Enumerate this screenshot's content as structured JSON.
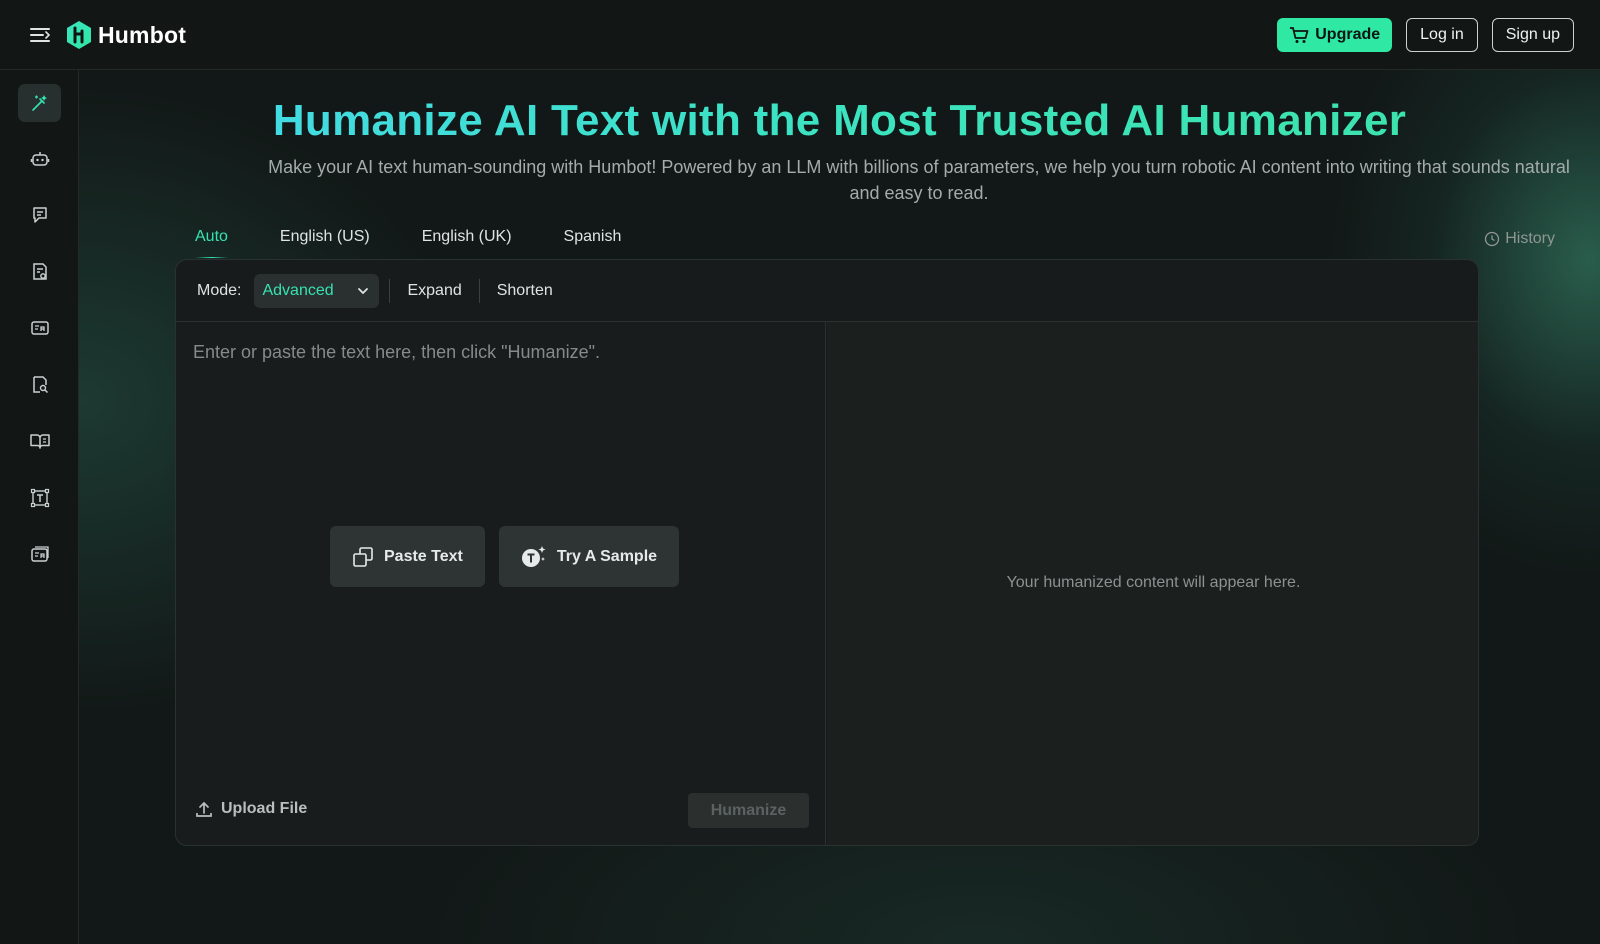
{
  "header": {
    "logo_text": "Humbot",
    "upgrade_label": "Upgrade",
    "login_label": "Log in",
    "signup_label": "Sign up"
  },
  "sidebar": {
    "items": [
      {
        "icon": "magic-pen-icon",
        "active": true
      },
      {
        "icon": "robot-icon",
        "active": false
      },
      {
        "icon": "chat-doc-icon",
        "active": false
      },
      {
        "icon": "doc-check-icon",
        "active": false
      },
      {
        "icon": "translate-icon",
        "active": false
      },
      {
        "icon": "doc-search-icon",
        "active": false
      },
      {
        "icon": "book-icon",
        "active": false
      },
      {
        "icon": "text-frame-icon",
        "active": false
      },
      {
        "icon": "translate-card-icon",
        "active": false
      }
    ]
  },
  "hero": {
    "title": "Humanize AI Text with the Most Trusted AI Humanizer",
    "subtitle": "Make your AI text human-sounding with Humbot! Powered by an LLM with billions of parameters, we help you turn robotic AI content into writing that sounds natural and easy to read."
  },
  "tabs": [
    {
      "label": "Auto",
      "active": true
    },
    {
      "label": "English (US)",
      "active": false
    },
    {
      "label": "English (UK)",
      "active": false
    },
    {
      "label": "Spanish",
      "active": false
    }
  ],
  "history_label": "History",
  "editor": {
    "mode_label": "Mode:",
    "mode_value": "Advanced",
    "expand_label": "Expand",
    "shorten_label": "Shorten",
    "input_placeholder": "Enter or paste the text here, then click \"Humanize\".",
    "paste_label": "Paste Text",
    "sample_label": "Try A Sample",
    "upload_label": "Upload File",
    "humanize_label": "Humanize",
    "output_placeholder": "Your humanized content will appear here."
  },
  "colors": {
    "accent": "#2ee8a3",
    "title_gradient_start": "#46d8ef",
    "title_gradient_end": "#3ee3a6",
    "background": "#121716"
  }
}
